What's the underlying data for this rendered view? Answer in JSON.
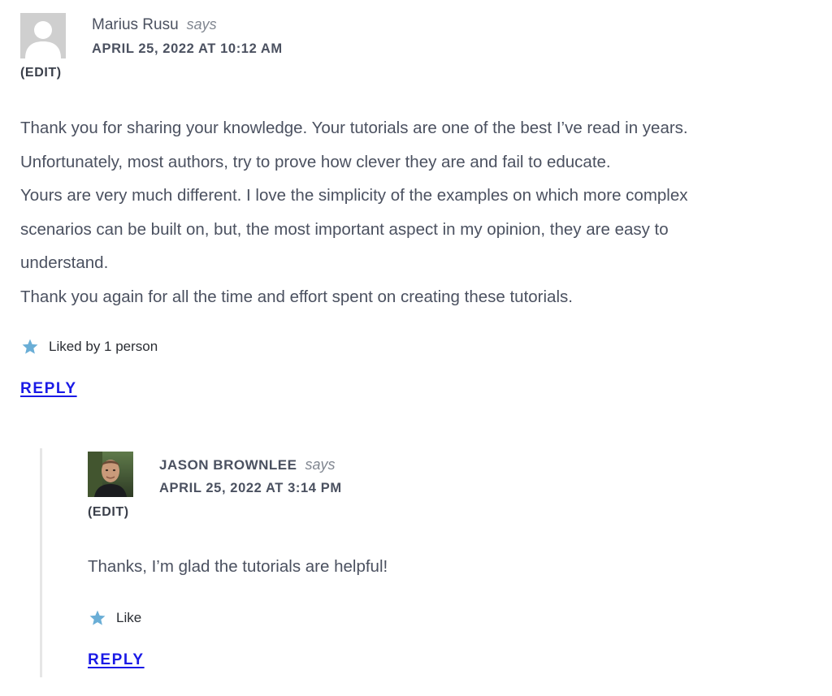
{
  "comments": [
    {
      "author": "Marius Rusu",
      "says": "says",
      "date": "APRIL 25, 2022 AT 10:12 AM",
      "edit": "(EDIT)",
      "avatar_icon": "default-avatar-icon",
      "paragraphs": [
        "Thank you for sharing your knowledge. Your tutorials are one of the best I’ve read in years.",
        "Unfortunately, most authors, try to prove how clever they are and fail to educate.",
        "Yours are very much different. I love the simplicity of the examples on which more complex",
        "scenarios can be built on, but, the most important aspect in my opinion, they are easy to",
        "understand.",
        "Thank you again for all the time and effort spent on creating these tutorials."
      ],
      "like_text": "Liked by 1 person",
      "reply_label": "REPLY"
    },
    {
      "author": "JASON BROWNLEE",
      "says": "says",
      "date": "APRIL 25, 2022 AT 3:14 PM",
      "edit": "(EDIT)",
      "avatar_icon": "author-photo-avatar",
      "paragraphs": [
        "Thanks, I’m glad the tutorials are helpful!"
      ],
      "like_text": "Like",
      "reply_label": "REPLY"
    }
  ],
  "colors": {
    "text": "#4b5160",
    "muted": "#808690",
    "star": "#6aaed6",
    "reply_link": "#1a1ae6",
    "thread_line": "#e6e6e6"
  }
}
